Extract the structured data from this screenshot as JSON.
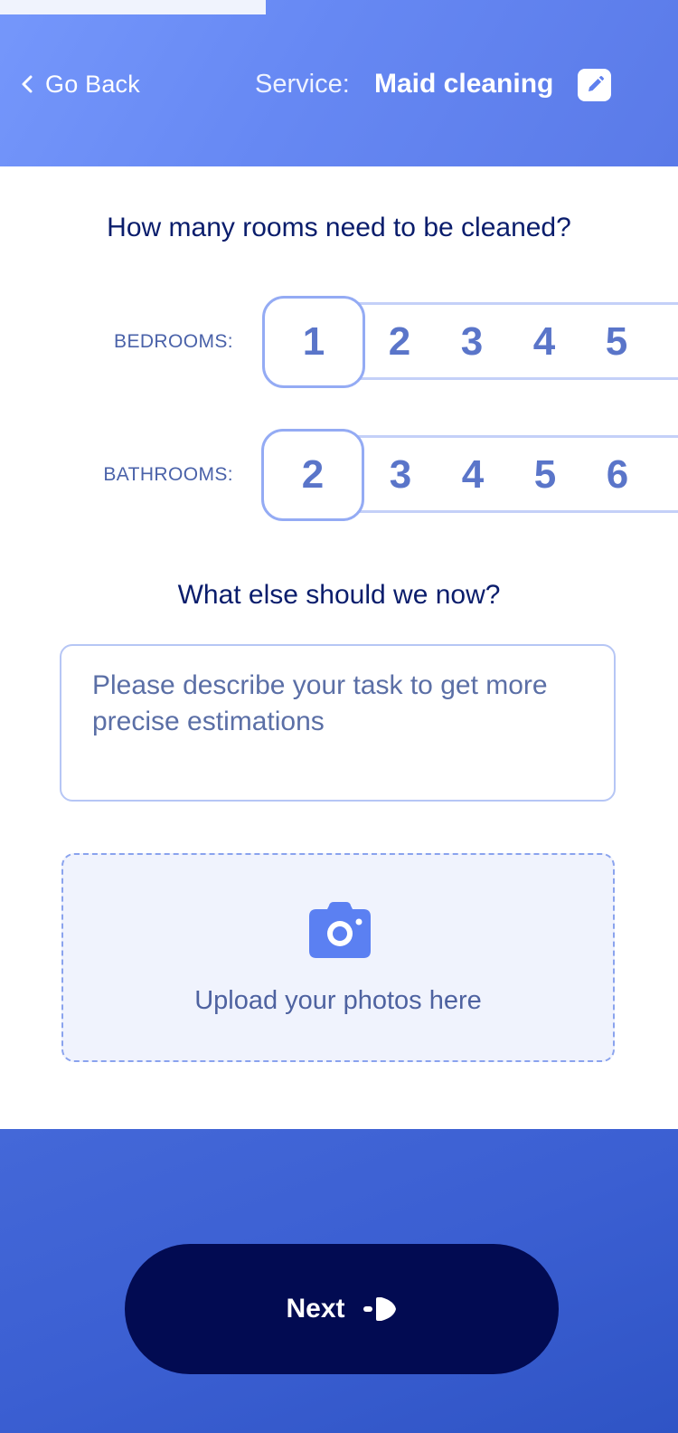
{
  "header": {
    "back_label": "Go Back",
    "service_label": "Service:",
    "service_value": "Maid cleaning"
  },
  "rooms": {
    "question": "How many rooms need to be cleaned?",
    "bedrooms": {
      "label": "BEDROOMS:",
      "options": [
        "1",
        "2",
        "3",
        "4",
        "5"
      ],
      "selected": "1"
    },
    "bathrooms": {
      "label": "BATHROOMS:",
      "options": [
        "2",
        "3",
        "4",
        "5",
        "6"
      ],
      "selected": "2"
    }
  },
  "details": {
    "question": "What else should we now?",
    "placeholder": "Please describe your task to get more precise estimations",
    "value": ""
  },
  "upload": {
    "label": "Upload your photos here",
    "icon": "camera-icon"
  },
  "footer": {
    "next_label": "Next",
    "next_icon": "arrow-right-icon"
  },
  "colors": {
    "header_gradient": [
      "#7597fb",
      "#5a7ae8"
    ],
    "heading_text": "#0a1d6c",
    "option_text": "#5a75c9",
    "option_border": "#94abf4",
    "upload_bg": "#f0f3fd",
    "footer_gradient": [
      "#4468d8",
      "#2f54c5"
    ],
    "button_bg": "#020b52"
  }
}
